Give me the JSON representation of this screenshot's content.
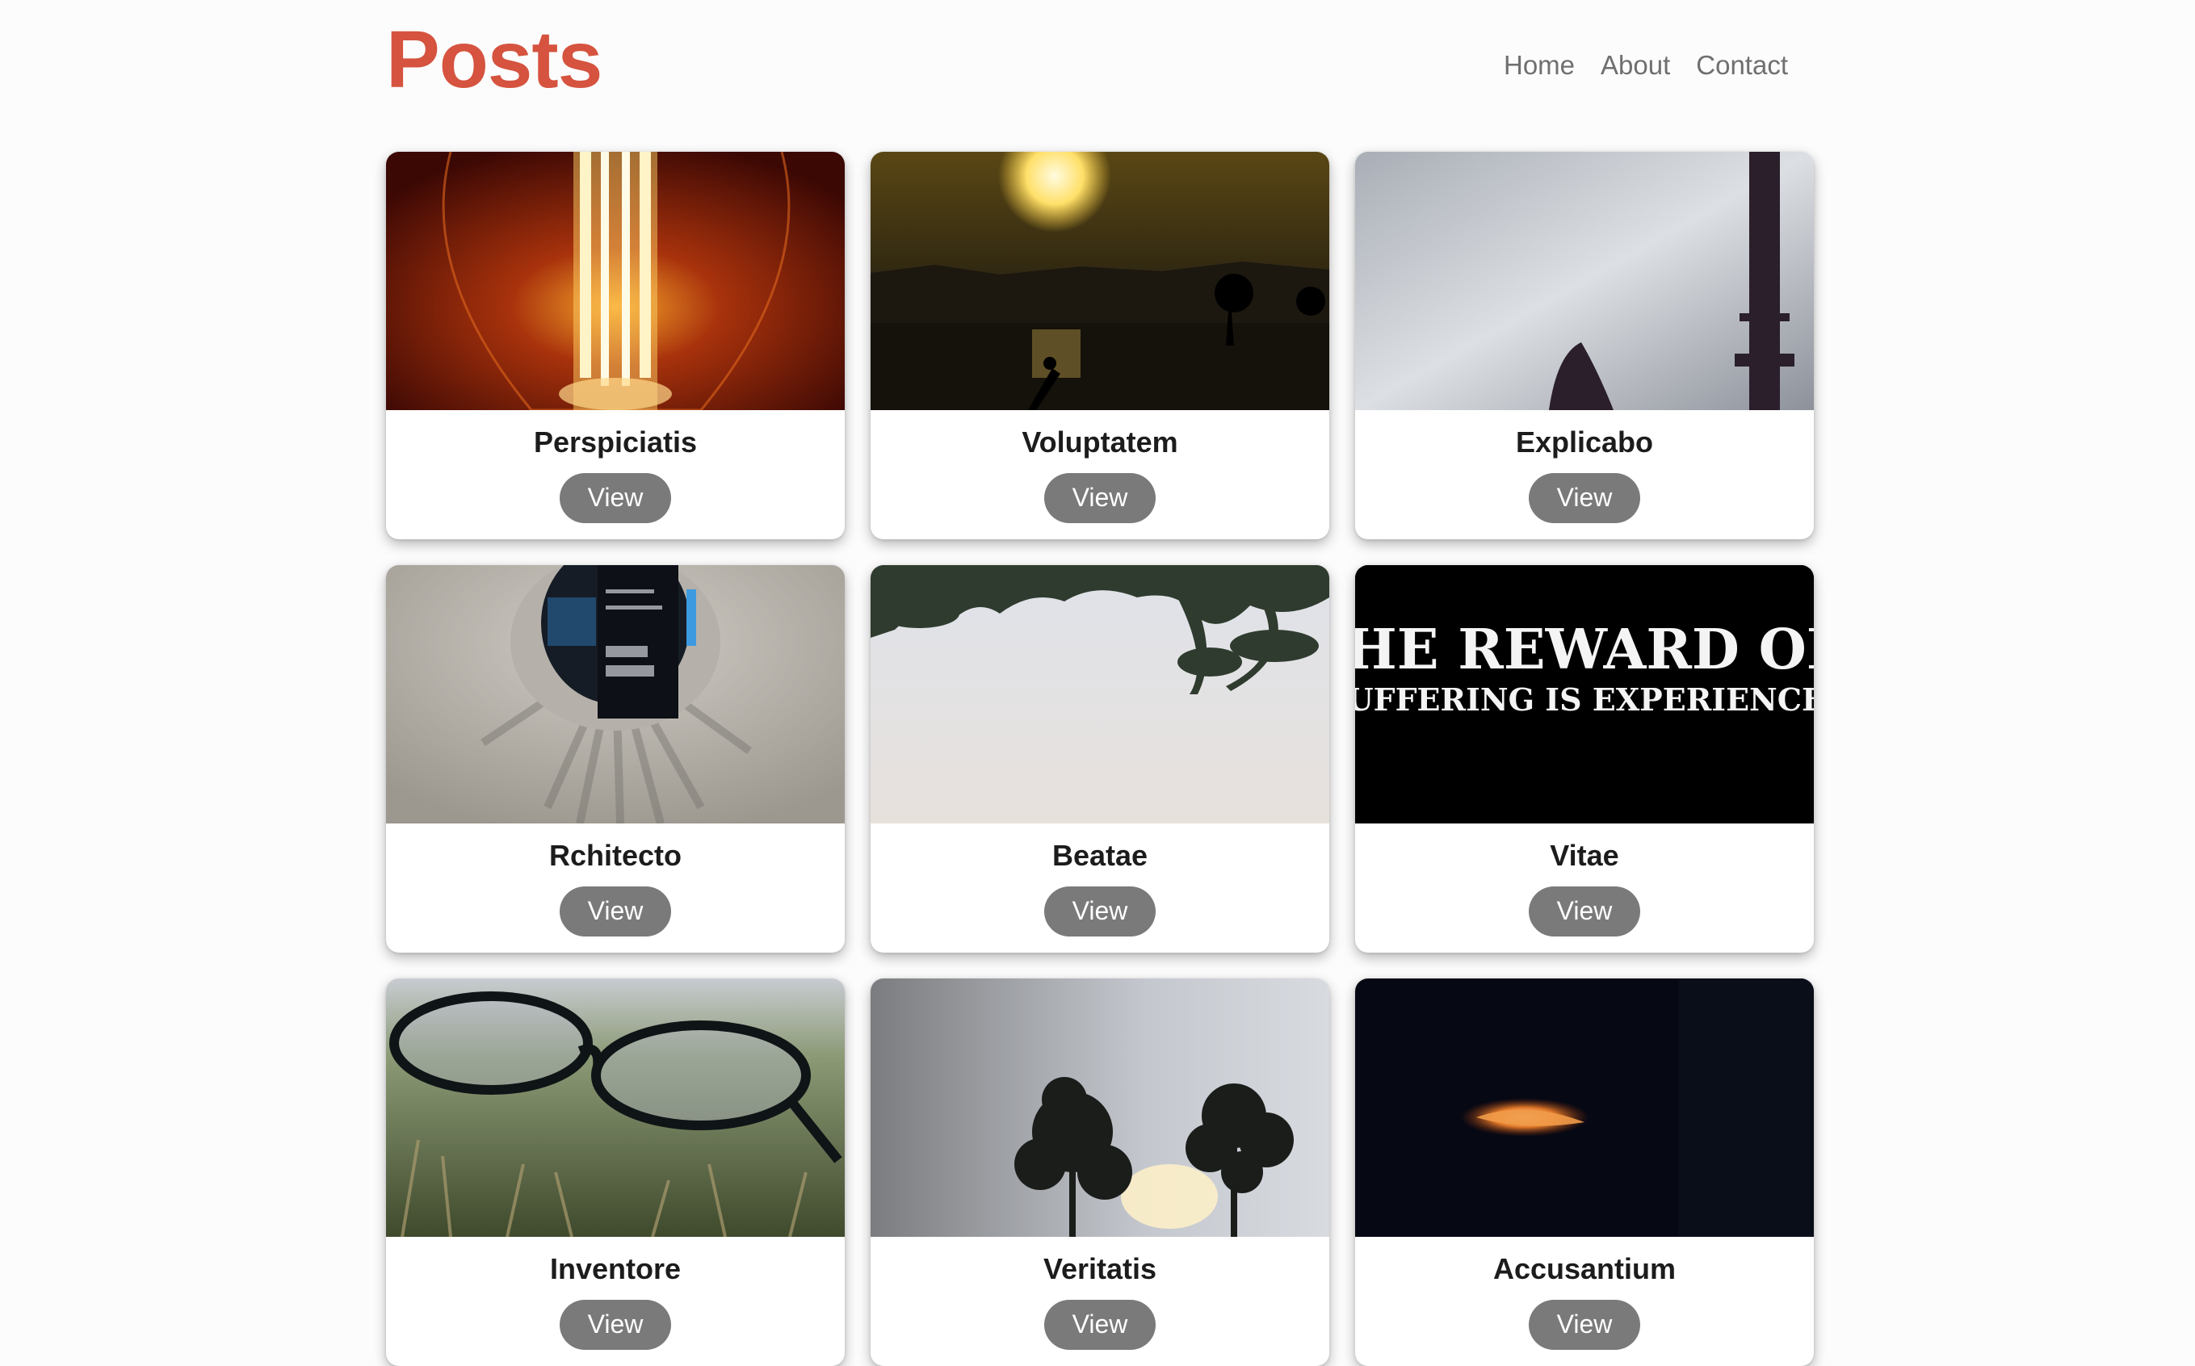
{
  "header": {
    "title": "Posts",
    "nav": [
      "Home",
      "About",
      "Contact"
    ]
  },
  "posts": [
    {
      "title": "Perspiciatis",
      "button": "View",
      "image": "light-bulb-filament"
    },
    {
      "title": "Voluptatem",
      "button": "View",
      "image": "sunset-lake-paddler"
    },
    {
      "title": "Explicabo",
      "button": "View",
      "image": "misty-fog"
    },
    {
      "title": "Rchitecto",
      "button": "View",
      "image": "book-hole-library"
    },
    {
      "title": "Beatae",
      "button": "View",
      "image": "tree-branches-sky"
    },
    {
      "title": "Vitae",
      "button": "View",
      "image": "quote-typography",
      "image_text": [
        "THE REWARD OF",
        "SUFFERING IS EXPERIENCE"
      ]
    },
    {
      "title": "Inventore",
      "button": "View",
      "image": "glasses-on-grass"
    },
    {
      "title": "Veritatis",
      "button": "View",
      "image": "pine-trees-sky"
    },
    {
      "title": "Accusantium",
      "button": "View",
      "image": "candle-flame-dark"
    }
  ]
}
